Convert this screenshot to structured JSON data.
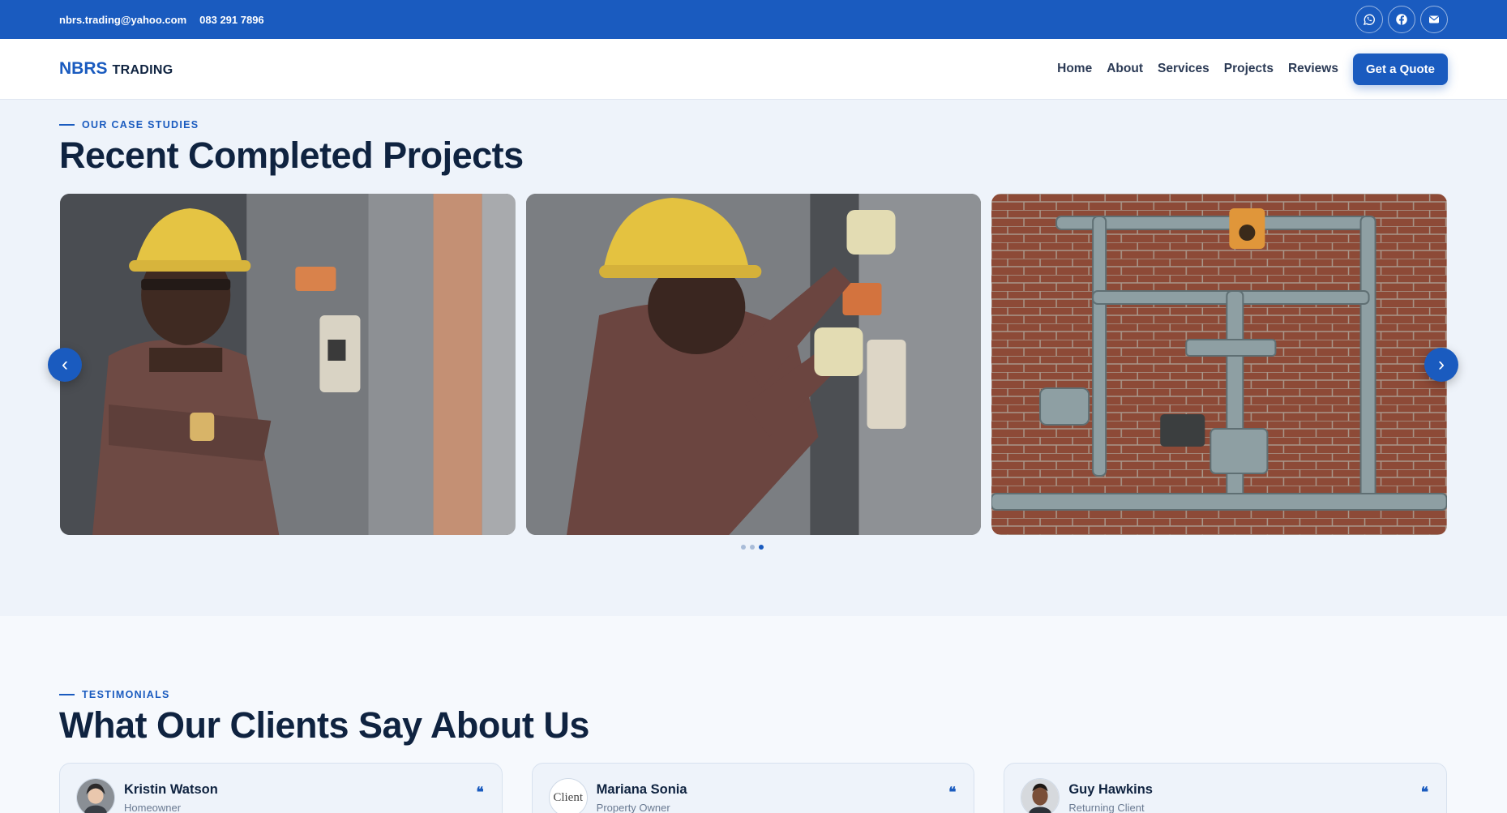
{
  "topbar": {
    "email": "nbrs.trading@yahoo.com",
    "phone": "083 291 7896",
    "icons": [
      "whatsapp-icon",
      "facebook-icon",
      "mail-icon"
    ]
  },
  "nav": {
    "logo_mark": "NBRS",
    "logo_word": "TRADING",
    "links": [
      "Home",
      "About",
      "Services",
      "Projects",
      "Reviews"
    ],
    "cta": "Get a Quote"
  },
  "projects": {
    "eyebrow": "OUR CASE STUDIES",
    "title": "Recent Completed Projects",
    "prev": "‹",
    "next": "›",
    "slides": [
      {
        "image": "worker-hardhat-portrait"
      },
      {
        "image": "worker-electrical-panel"
      },
      {
        "image": "gas-pipes-brick-wall"
      }
    ],
    "active_dot": 3,
    "dot_count": 3
  },
  "testimonials": {
    "eyebrow": "TESTIMONIALS",
    "title": "What Our Clients Say About Us",
    "quote_glyph": "❝",
    "items": [
      {
        "name": "Kristin Watson",
        "role": "Homeowner",
        "avatar": "photo"
      },
      {
        "name": "Mariana Sonia",
        "role": "Property Owner",
        "avatar": "Client"
      },
      {
        "name": "Guy Hawkins",
        "role": "Returning Client",
        "avatar": "photo"
      }
    ]
  },
  "colors": {
    "brand": "#1a5bbf",
    "dark": "#0f2340",
    "bg": "#eef3fa"
  }
}
